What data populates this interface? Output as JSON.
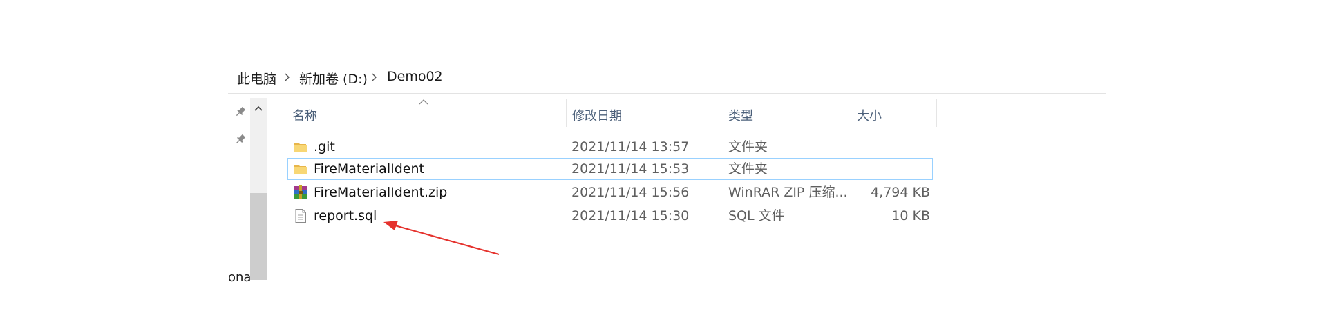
{
  "breadcrumb": {
    "items": [
      "此电脑",
      "新加卷 (D:)",
      "Demo02"
    ]
  },
  "nav": {
    "cut_text": "onal"
  },
  "columns": {
    "name": "名称",
    "date": "修改日期",
    "type": "类型",
    "size": "大小"
  },
  "files": [
    {
      "name": ".git",
      "date": "2021/11/14 13:57",
      "type": "文件夹",
      "size": "",
      "icon": "folder-icon"
    },
    {
      "name": "FireMaterialIdent",
      "date": "2021/11/14 15:53",
      "type": "文件夹",
      "size": "",
      "icon": "folder-icon"
    },
    {
      "name": "FireMaterialIdent.zip",
      "date": "2021/11/14 15:56",
      "type": "WinRAR ZIP 压缩...",
      "size": "4,794 KB",
      "icon": "winrar-archive-icon"
    },
    {
      "name": "report.sql",
      "date": "2021/11/14 15:30",
      "type": "SQL 文件",
      "size": "10 KB",
      "icon": "text-file-icon"
    }
  ],
  "colors": {
    "selection_border": "#99d1ff",
    "annotation_arrow": "#e5322d",
    "header_text": "#4c607a"
  }
}
